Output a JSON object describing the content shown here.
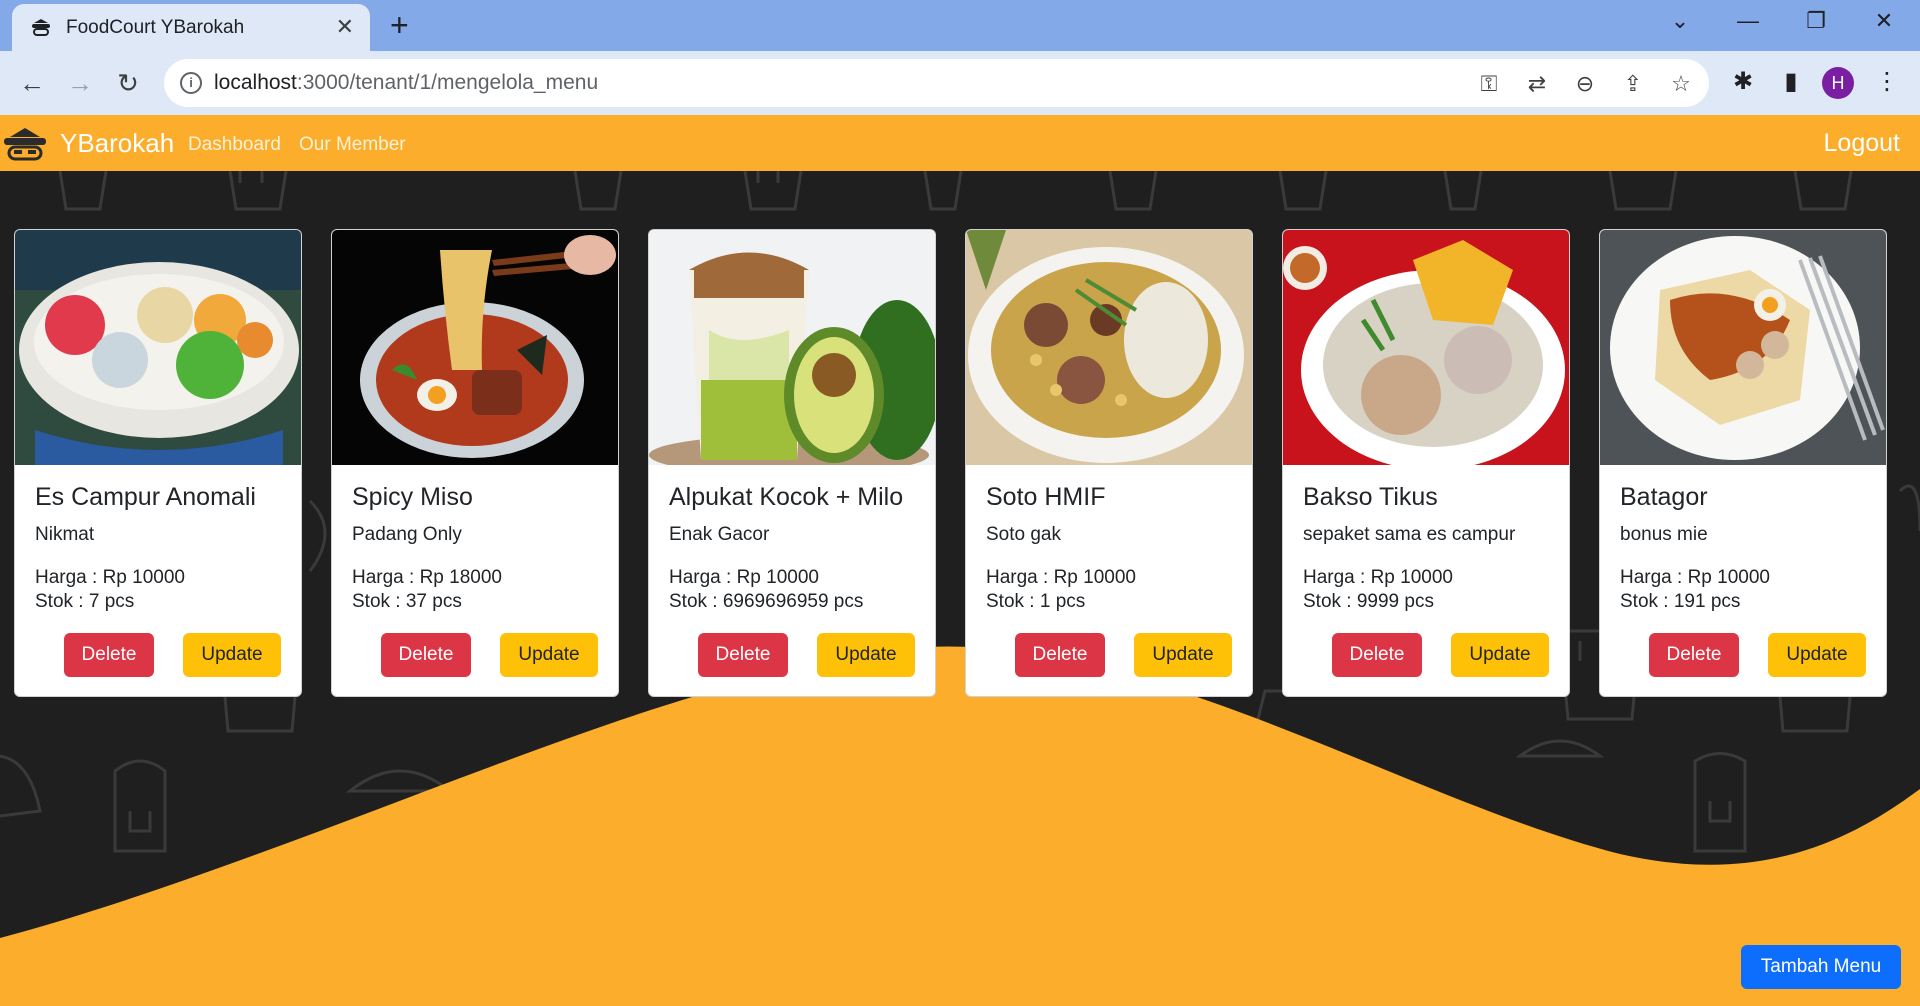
{
  "browser": {
    "tab_title": "FoodCourt YBarokah",
    "url_host": "localhost",
    "url_path": ":3000/tenant/1/mengelola_menu",
    "profile_initial": "H"
  },
  "navbar": {
    "brand": "YBarokah",
    "links": [
      "Dashboard",
      "Our Member"
    ],
    "logout": "Logout"
  },
  "cards": [
    {
      "name": "Es Campur Anomali",
      "description": "Nikmat",
      "price": "Harga : Rp 10000",
      "stock": "Stok : 7 pcs",
      "delete_label": "Delete",
      "update_label": "Update"
    },
    {
      "name": "Spicy Miso",
      "description": "Padang Only",
      "price": "Harga : Rp 18000",
      "stock": "Stok : 37 pcs",
      "delete_label": "Delete",
      "update_label": "Update"
    },
    {
      "name": "Alpukat Kocok + Milo",
      "description": "Enak Gacor",
      "price": "Harga : Rp 10000",
      "stock": "Stok : 6969696959 pcs",
      "delete_label": "Delete",
      "update_label": "Update"
    },
    {
      "name": "Soto HMIF",
      "description": "Soto gak",
      "price": "Harga : Rp 10000",
      "stock": "Stok : 1 pcs",
      "delete_label": "Delete",
      "update_label": "Update"
    },
    {
      "name": "Bakso Tikus",
      "description": "sepaket sama es campur",
      "price": "Harga : Rp 10000",
      "stock": "Stok : 9999 pcs",
      "delete_label": "Delete",
      "update_label": "Update"
    },
    {
      "name": "Batagor",
      "description": "bonus mie",
      "price": "Harga : Rp 10000",
      "stock": "Stok : 191 pcs",
      "delete_label": "Delete",
      "update_label": "Update"
    }
  ],
  "add_menu_label": "Tambah Menu",
  "colors": {
    "navbar": "#fbad2b",
    "page_background": "#1f1f1f",
    "wave": "#fbad2b",
    "delete": "#dc3545",
    "update": "#ffc107",
    "primary": "#0d6efd"
  }
}
